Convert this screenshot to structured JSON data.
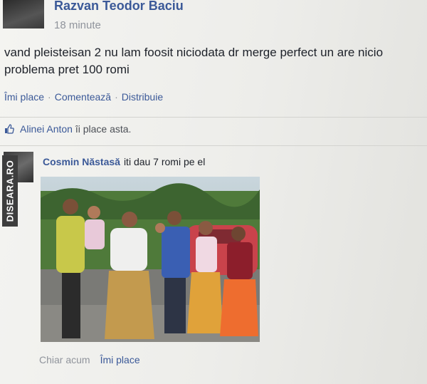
{
  "post": {
    "author": "Razvan Teodor Baciu",
    "time": "18 minute",
    "text": "vand pleisteisan 2 nu lam foosit niciodata dr merge perfect un are nicio problema pret 100 romi",
    "actions": {
      "like": "Îmi place",
      "comment": "Comentează",
      "share": "Distribuie",
      "separator": "·"
    },
    "likes": {
      "name": "Alinei Anton",
      "suffix": "îi place asta."
    }
  },
  "comment": {
    "author": "Cosmin Năstasă",
    "text": "iti dau 7 romi pe el",
    "time": "Chiar acum",
    "like": "Îmi place"
  },
  "watermark": "DISEARA.RO",
  "colors": {
    "link": "#3b5998",
    "meta": "#90949c",
    "text": "#1d2129"
  }
}
